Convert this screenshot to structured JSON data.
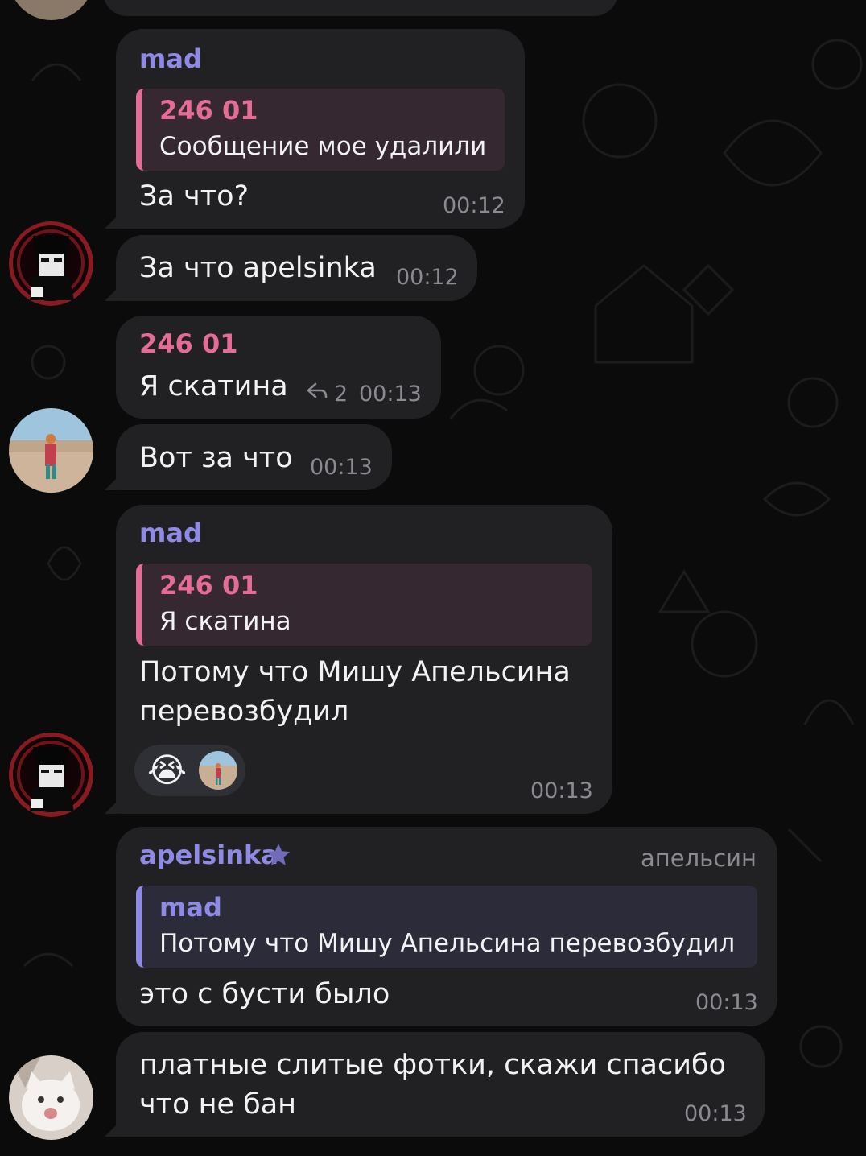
{
  "messages": [
    {
      "sender": "mad",
      "reply_name": "246 01",
      "reply_text": "Сообщение мое удалили",
      "text": "За что?",
      "time": "00:12"
    },
    {
      "text": "За что apelsinka",
      "time": "00:12"
    },
    {
      "sender": "246 01",
      "text": "Я скатина",
      "replies": "2",
      "time": "00:13"
    },
    {
      "text": "Вот за что",
      "time": "00:13"
    },
    {
      "sender": "mad",
      "reply_name": "246 01",
      "reply_text": "Я скатина",
      "text_line1": "Потому что Мишу Апельсина",
      "text_line2": "перевозбудил",
      "reaction_emoji": "😭",
      "time": "00:13"
    },
    {
      "sender": "apelsinka",
      "badge": "апельсин",
      "reply_name": "mad",
      "reply_text": "Потому что Мишу Апельсина перевозбудил",
      "text": "это с бусти было",
      "time": "00:13"
    },
    {
      "text_line1": "платные слитые фотки, скажи спасибо",
      "text_line2": "что не бан",
      "time": "00:13"
    }
  ],
  "colors": {
    "accent_purple": "#8f8ae6",
    "accent_pink": "#e46c95",
    "bubble": "#212124",
    "background": "#0b0b0c"
  }
}
